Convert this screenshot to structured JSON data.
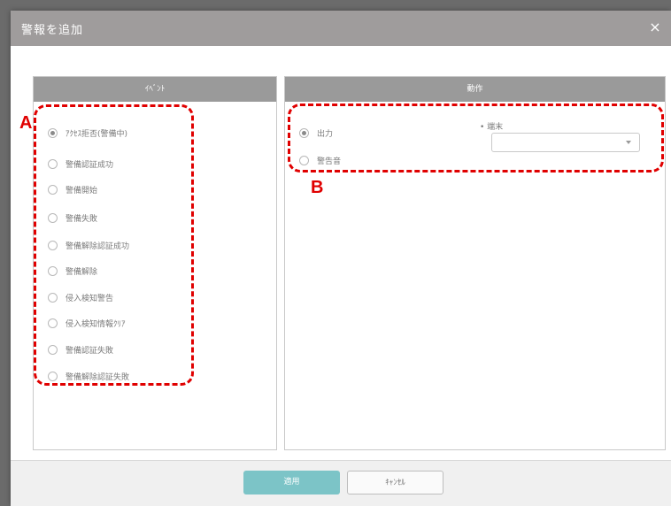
{
  "dialog": {
    "title": "警報を追加",
    "close_glyph": "×"
  },
  "event_panel": {
    "header": "ｲﾍﾞﾝﾄ",
    "items": [
      {
        "label": "ｱｸｾｽ拒否(警備中)",
        "checked": true
      },
      {
        "label": "警備認証成功",
        "checked": false
      },
      {
        "label": "警備開始",
        "checked": false
      },
      {
        "label": "警備失敗",
        "checked": false
      },
      {
        "label": "警備解除認証成功",
        "checked": false
      },
      {
        "label": "警備解除",
        "checked": false
      },
      {
        "label": "侵入検知警告",
        "checked": false
      },
      {
        "label": "侵入検知情報ｸﾘｱ",
        "checked": false
      },
      {
        "label": "警備認証失敗",
        "checked": false
      },
      {
        "label": "警備解除認証失敗",
        "checked": false
      }
    ]
  },
  "action_panel": {
    "header": "動作",
    "options": [
      {
        "label": "出力",
        "checked": true
      },
      {
        "label": "警告音",
        "checked": false
      }
    ],
    "terminal": {
      "label": "• 端末",
      "value": ""
    }
  },
  "annotations": {
    "a": "A",
    "b": "B",
    "color": "#e00000"
  },
  "footer": {
    "apply_label": "適用",
    "cancel_label": "ｷｬﾝｾﾙ"
  }
}
